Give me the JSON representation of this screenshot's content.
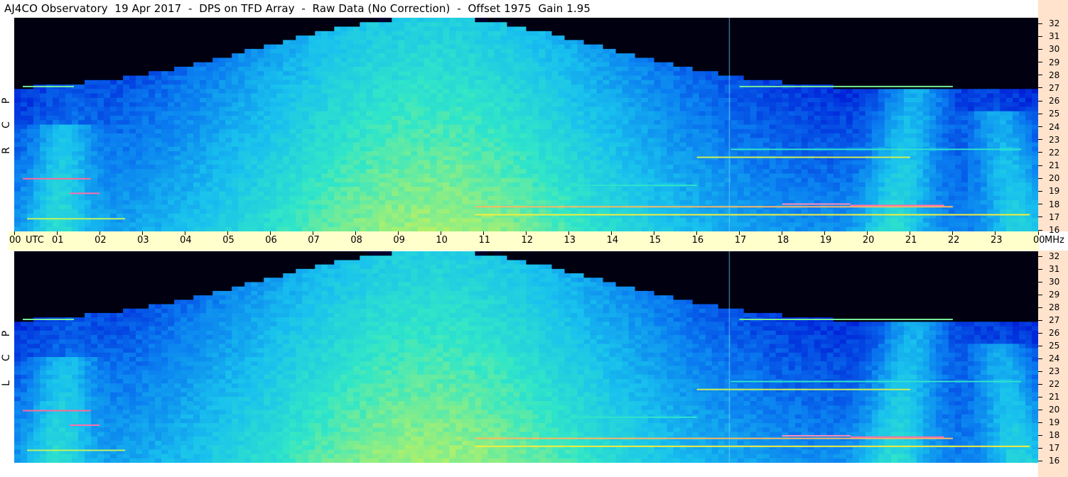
{
  "title": "AJ4CO Observatory  19 Apr 2017  -  DPS on TFD Array  -  Raw Data (No Correction)  -  Offset 1975  Gain 1.95",
  "colors": {
    "background": "#ffffff",
    "time_axis_bg": "#ffffcc",
    "freq_axis_bg": "#ffe3cc",
    "colormap": [
      "#000010",
      "#00006a",
      "#0020d8",
      "#0a7cf0",
      "#18c0ee",
      "#30e6c8",
      "#a8f070",
      "#f4f03a",
      "#ff60a0",
      "#ffffff"
    ]
  },
  "chart_data": [
    {
      "type": "heatmap",
      "name": "RCP",
      "ylabel": "R C P",
      "x": {
        "unit": "UTC",
        "range": [
          "00",
          "00"
        ],
        "ticks": [
          "00",
          "01",
          "02",
          "03",
          "04",
          "05",
          "06",
          "07",
          "08",
          "09",
          "10",
          "11",
          "12",
          "13",
          "14",
          "15",
          "16",
          "17",
          "18",
          "19",
          "20",
          "21",
          "22",
          "23",
          "00"
        ]
      },
      "y": {
        "unit": "MHz",
        "range": [
          16,
          32
        ],
        "ticks": [
          16,
          17,
          18,
          19,
          20,
          21,
          22,
          23,
          24,
          25,
          26,
          27,
          28,
          29,
          30,
          31,
          32
        ]
      }
    },
    {
      "type": "heatmap",
      "name": "LCP",
      "ylabel": "L C P",
      "x": {
        "unit": "UTC",
        "range": [
          "00",
          "00"
        ],
        "ticks": [
          "00",
          "01",
          "02",
          "03",
          "04",
          "05",
          "06",
          "07",
          "08",
          "09",
          "10",
          "11",
          "12",
          "13",
          "14",
          "15",
          "16",
          "17",
          "18",
          "19",
          "20",
          "21",
          "22",
          "23",
          "00"
        ]
      },
      "y": {
        "unit": "MHz",
        "range": [
          16,
          32
        ],
        "ticks": [
          16,
          17,
          18,
          19,
          20,
          21,
          22,
          23,
          24,
          25,
          26,
          27,
          28,
          29,
          30,
          31,
          32
        ]
      }
    }
  ],
  "time_axis": {
    "utc_label": "UTC",
    "mhz_label": "MHz"
  },
  "polarization_labels": [
    [
      "R",
      "C",
      "P"
    ],
    [
      "L",
      "C",
      "P"
    ]
  ]
}
